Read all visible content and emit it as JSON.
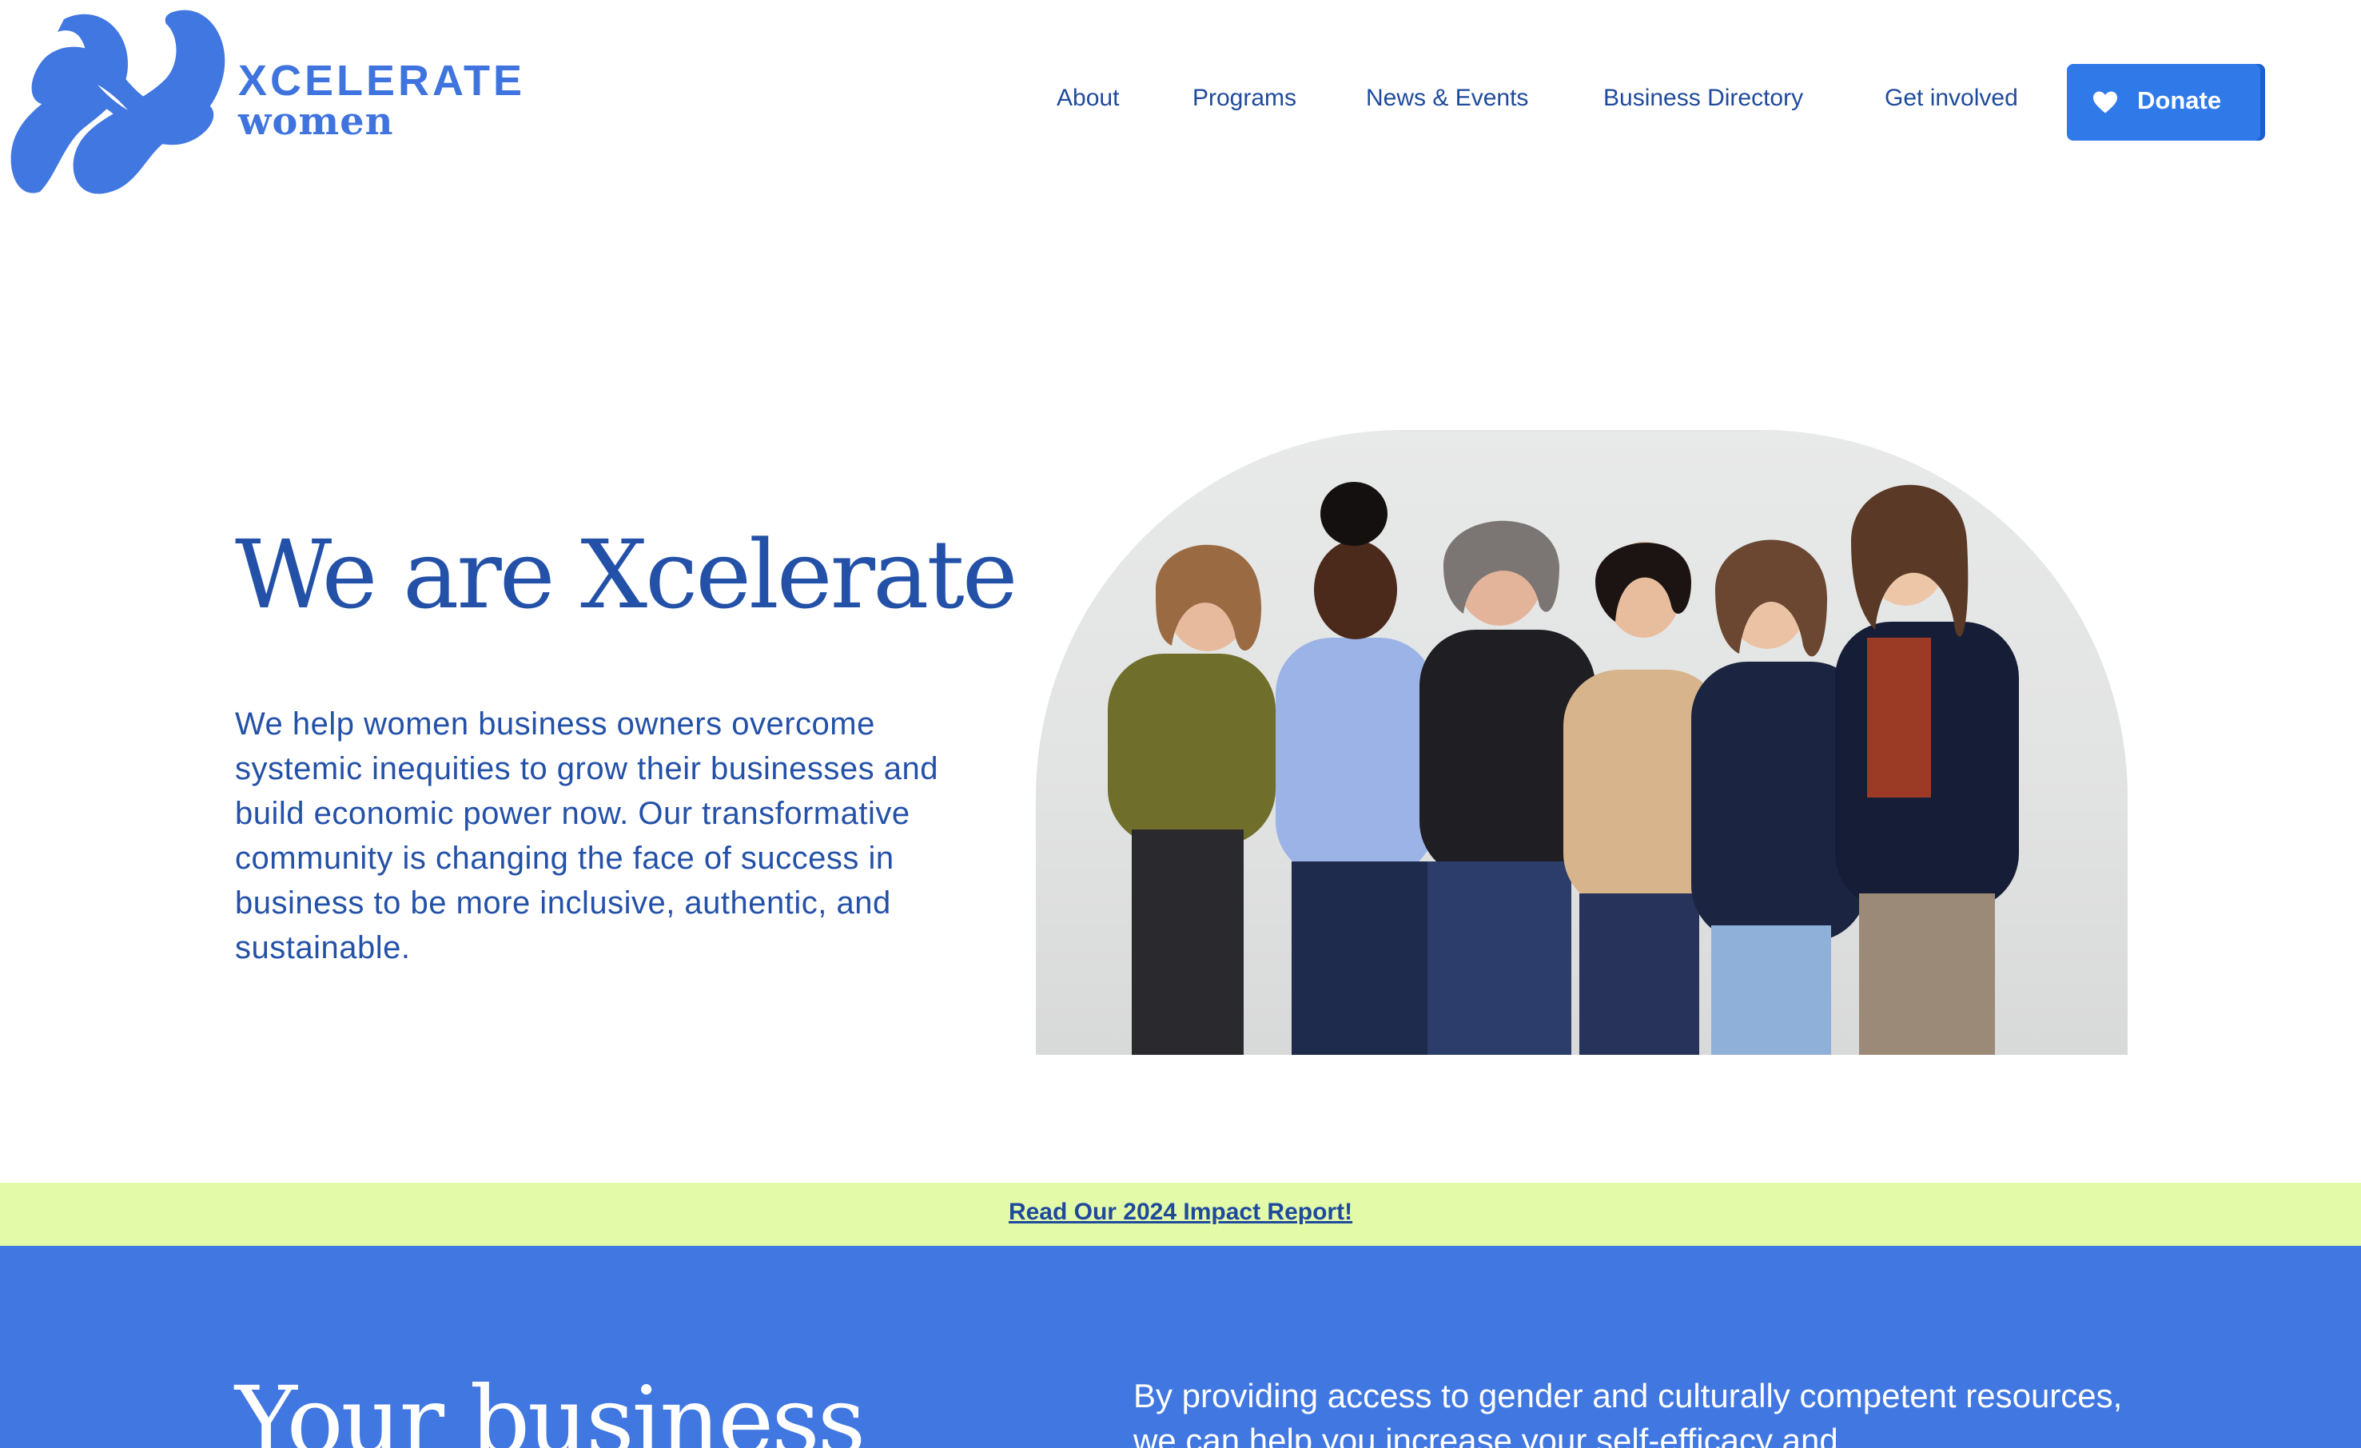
{
  "brand": {
    "line1": "XCELERATE",
    "line2": "women",
    "color": "#3f74df"
  },
  "nav": {
    "items": [
      "About",
      "Programs",
      "News & Events",
      "Business Directory",
      "Get involved"
    ],
    "donate_label": "Donate",
    "donate_color": "#2f7ae8"
  },
  "hero": {
    "title": "We are Xcelerate",
    "body": "We help women business owners overcome systemic inequities to grow their businesses and build economic power now. Our transformative community is changing the face of success in business to be more inclusive, authentic, and sustainable."
  },
  "banner": {
    "link_text": "Read Our 2024 Impact Report!",
    "background": "#e3fba9"
  },
  "section": {
    "title": "Your business",
    "body": "By providing access to gender and culturally competent resources, we can help you increase your self-efficacy and",
    "background": "#4077e0"
  },
  "colors": {
    "text_primary": "#2451a8",
    "nav_text": "#1f4a9c"
  }
}
